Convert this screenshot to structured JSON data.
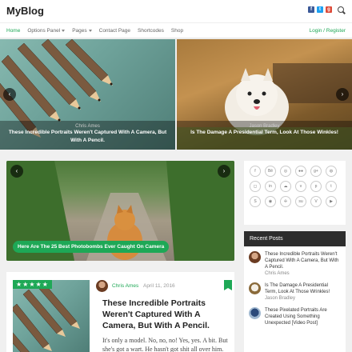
{
  "header": {
    "logo": "MyBlog",
    "social": [
      {
        "icon": "facebook-icon",
        "glyph": "f",
        "color": "#3b5998"
      },
      {
        "icon": "twitter-icon",
        "glyph": "t",
        "color": "#1da1f2"
      },
      {
        "icon": "google-plus-icon",
        "glyph": "g",
        "color": "#dd4b39"
      }
    ]
  },
  "nav": {
    "items": [
      "Home",
      "Options Panel",
      "Pages",
      "Contact Page",
      "Shortcodes",
      "Shop"
    ],
    "active": "Home",
    "login": "Login / Register"
  },
  "slider": {
    "slides": [
      {
        "author": "Chris Ames",
        "title": "These Incredible Portraits Weren't Captured With A Camera, But With A Pencil."
      },
      {
        "author": "Jason Bradley",
        "title": "Is The Damage A Presidential Term, Look At Those Winkles!"
      }
    ]
  },
  "featured": {
    "caption": "Here Are The 25 Best Photobombs Ever Caught On Camera"
  },
  "sidebar": {
    "social_icons": [
      "facebook",
      "behance",
      "dribbble",
      "flickr",
      "google-plus",
      "github",
      "instagram",
      "linkedin",
      "soundcloud",
      "vimeo",
      "pinterest",
      "tumblr",
      "skype",
      "reddit",
      "deviantart",
      "stumbleupon",
      "vine",
      "youtube"
    ],
    "recent_posts_heading": "Recent Posts",
    "recent_posts": [
      {
        "title": "These Incredible Portraits Weren't Captured With A Camera, But With A Pencil.",
        "author": "Chris Ames"
      },
      {
        "title": "Is The Damage A Presidential Term, Look At Those Wrinkles!",
        "author": "Jason Bradley"
      },
      {
        "title": "These Pixelated Portraits Are Created Using Something Unexpected [Video Post]",
        "author": ""
      }
    ]
  },
  "article": {
    "rating_stars": "★★★★★",
    "author": "Chris Ames",
    "date": "April 11, 2016",
    "title": "These Incredible Portraits Weren't Captured With A Camera, But With A Pencil.",
    "excerpt": "It's only a model. No, no, no! Yes, yes. A bit. But she's got a wart. He hasn't got shit all over him."
  }
}
